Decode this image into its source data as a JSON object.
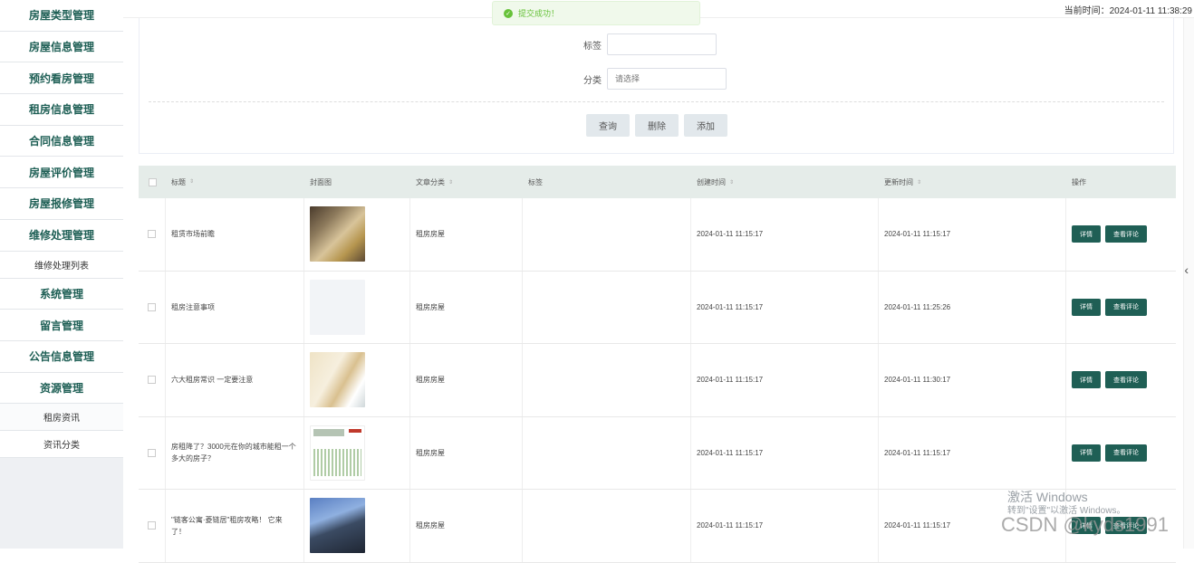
{
  "sidebar": {
    "items": [
      {
        "label": "房屋类型管理"
      },
      {
        "label": "房屋信息管理"
      },
      {
        "label": "预约看房管理"
      },
      {
        "label": "租房信息管理"
      },
      {
        "label": "合同信息管理"
      },
      {
        "label": "房屋评价管理"
      },
      {
        "label": "房屋报修管理"
      },
      {
        "label": "维修处理管理"
      },
      {
        "label": "维修处理列表",
        "sub": true
      },
      {
        "label": "系统管理"
      },
      {
        "label": "留言管理"
      },
      {
        "label": "公告信息管理"
      },
      {
        "label": "资源管理"
      },
      {
        "label": "租房资讯",
        "sub": true
      },
      {
        "label": "资讯分类",
        "sub": true
      }
    ]
  },
  "header": {
    "current_time": "当前时间：2024-01-11 11:38:29"
  },
  "toast": {
    "message": "提交成功！"
  },
  "search": {
    "tag_label": "标签",
    "tag_value": "",
    "category_label": "分类",
    "category_placeholder": "请选择",
    "query_button": "查询",
    "delete_button": "删除",
    "add_button": "添加"
  },
  "table": {
    "headers": {
      "title": "标题",
      "cover": "封面图",
      "category": "文章分类",
      "tag": "标签",
      "created": "创建时间",
      "updated": "更新时间",
      "ops": "操作"
    },
    "detail_button": "详情",
    "comments_button": "查看评论",
    "rows": [
      {
        "title": "租赁市场前瞻",
        "category": "租房房屋",
        "tag": "",
        "created": "2024-01-11 11:15:17",
        "updated": "2024-01-11 11:15:17"
      },
      {
        "title": "租房注意事项",
        "category": "租房房屋",
        "tag": "",
        "created": "2024-01-11 11:15:17",
        "updated": "2024-01-11 11:25:26"
      },
      {
        "title": "六大租房常识 一定要注意",
        "category": "租房房屋",
        "tag": "",
        "created": "2024-01-11 11:15:17",
        "updated": "2024-01-11 11:30:17"
      },
      {
        "title": "房租降了？3000元在你的城市能租一个多大的房子？",
        "category": "租房房屋",
        "tag": "",
        "created": "2024-01-11 11:15:17",
        "updated": "2024-01-11 11:15:17"
      },
      {
        "title": "\"链客公寓·菱链居\"租房攻略！ 它来了！",
        "category": "租房房屋",
        "tag": "",
        "created": "2024-01-11 11:15:17",
        "updated": "2024-01-11 11:15:17"
      }
    ]
  },
  "watermarks": {
    "windows_line1": "激活 Windows",
    "windows_line2": "转到\"设置\"以激活 Windows。",
    "csdn": "CSDN @kyds1991"
  },
  "icons": [
    "success-icon",
    "sort-icon",
    "chevron-left-icon",
    "checkbox-icon"
  ],
  "colors": {
    "accent": "#1f5f55",
    "sidebar_text": "#1e5f55",
    "toast_green": "#67c23a",
    "table_header_bg": "#e5ece9"
  }
}
